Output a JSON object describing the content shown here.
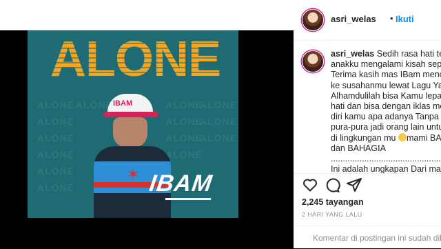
{
  "post": {
    "poster_title": "ALONE",
    "poster_bg_word": "ALONE",
    "poster_artist": "IBAM",
    "cap_text": "IBAM"
  },
  "header": {
    "username": "asri_welas",
    "separator": "•",
    "follow_label": "Ikuti"
  },
  "caption": {
    "username": "asri_welas",
    "lines": [
      "Sedih rasa hati terny",
      "anakku mengalami kisah sepert",
      "Terima kasih mas IBam menceri",
      "ke susahanmu lewat Lagu Yang",
      "Alhamdulilah bisa Kamu lepas k",
      "hati dan bisa dengan iklas mene",
      "diri kamu apa adanya Tanpa har",
      "pura-pura jadi orang lain untuk",
      "di lingkungan mu ",
      "mami BANG",
      "dan BAHAGIA",
      "................................................",
      "Ini adalah ungkapan Dari mas"
    ]
  },
  "actions": {
    "views": "2,245 tayangan",
    "time": "2 HARI YANG LALU"
  },
  "comment_box": {
    "disabled_text": "Komentar di postingan ini sudah diba"
  },
  "colors": {
    "poster_bg": "#1f6b73",
    "title_orange": "#f4a623",
    "link_blue": "#0095f6"
  }
}
